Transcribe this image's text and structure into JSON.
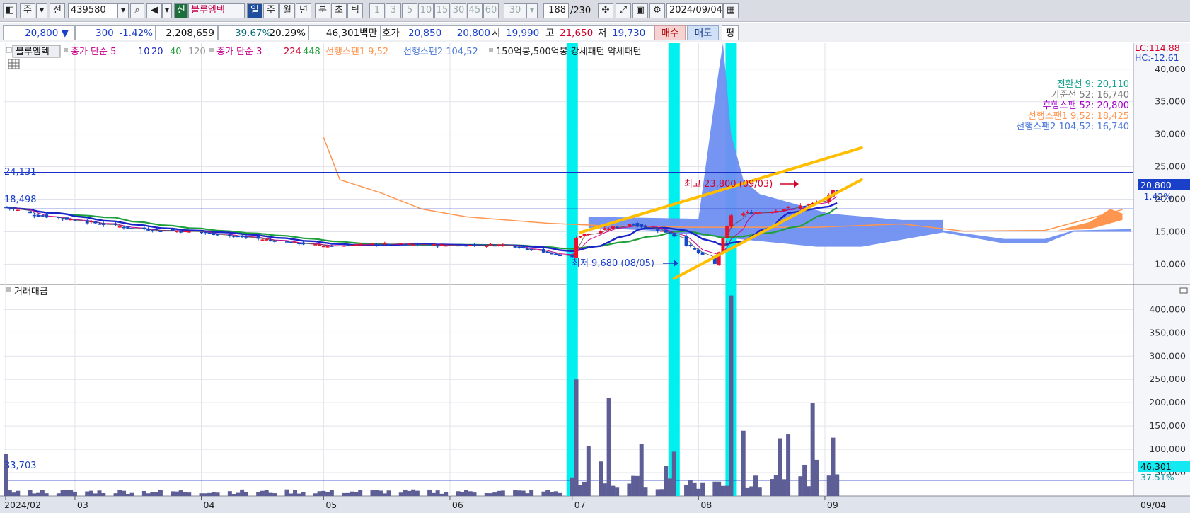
{
  "toolbar": {
    "period": "주",
    "prev": "전",
    "code": "439580",
    "new_badge": "신",
    "stock_name": "블루엠텍",
    "tf_day": "일",
    "tf_week": "주",
    "tf_month": "월",
    "tf_year": "년",
    "tf_min": "분",
    "tf_sec": "초",
    "tf_tick": "틱",
    "intervals": [
      "1",
      "3",
      "5",
      "10",
      "15",
      "30",
      "45",
      "60"
    ],
    "interval_select": "30",
    "count": "188",
    "count_total": "/230",
    "date": "2024/09/04"
  },
  "quote": {
    "price": "20,800",
    "change_arrow": "▼",
    "change": "300",
    "change_pct": "-1.42%",
    "volume": "2,208,659",
    "turnover_ratio": "39.67%",
    "vol_ratio": "20.29%",
    "amount": "46,301백만",
    "hoga_label": "호가",
    "ask": "20,850",
    "bid": "20,800",
    "open_label": "시",
    "open": "19,990",
    "high_label": "고",
    "high": "21,650",
    "low_label": "저",
    "low": "19,730",
    "buy": "매수",
    "sell": "매도",
    "avg": "평"
  },
  "legend": {
    "name": "블루엠텍",
    "ma1_label": "종가 단순 5",
    "ma1_periods": [
      "10",
      "20",
      "40",
      "120"
    ],
    "ma2_label": "종가 단순 3",
    "ma2_periods": [
      "224",
      "448"
    ],
    "span1": "선행스팬1 9,52",
    "span2": "선행스팬2 104,52",
    "pattern": "150억봉,500억봉 강세패턴 약세패턴",
    "lc": "LC:114.88",
    "hc": "HC:-12.61"
  },
  "ichimoku_info": [
    {
      "text": "전환선 9: 20,110",
      "color": "#14a08a"
    },
    {
      "text": "기준선 52: 16,740",
      "color": "#7a7a7a"
    },
    {
      "text": "후행스팬 52: 20,800",
      "color": "#a000c8"
    },
    {
      "text": "선행스팬1 9,52: 18,425",
      "color": "#ff9650"
    },
    {
      "text": "선행스팬2 104,52: 16,740",
      "color": "#4a78d8"
    }
  ],
  "annotations": {
    "level_high": "24,131",
    "level_mid": "18,498",
    "max_label": "최고 23,800 (09/03)",
    "min_label": "최저 9,680 (08/05)",
    "last_price": "20,800",
    "last_pct": "-1.42%",
    "vol_level": "33,703",
    "vol_last": "46,301",
    "vol_pct": "37.51%"
  },
  "volume_title": "거래대금",
  "colors": {
    "up": "#e8102c",
    "down": "#1548c8",
    "highlight": "#00f0f0",
    "channel": "#ffbe00",
    "cloud": "#6f8ef0",
    "cloud_pos": "#ff9650",
    "ma_blue": "#1a24c8",
    "ma_green": "#1fa03c",
    "volume": "#5e5e96"
  },
  "chart_data": [
    {
      "type": "candlestick",
      "title": "블루엠텍",
      "ylim": [
        7000,
        44000
      ],
      "y_ticks": [
        "40,000",
        "35,000",
        "30,000",
        "25,000",
        "20,000",
        "15,000",
        "10,000"
      ],
      "x_tick_labels": [
        "2024/02",
        "03",
        "04",
        "05",
        "06",
        "07",
        "08",
        "09"
      ],
      "date_axis_right": "09/04",
      "notable": {
        "max": 23800,
        "max_date": "09/03",
        "min": 9680,
        "min_date": "08/05",
        "last": 20800,
        "level_high": 24131,
        "level_mid": 18498
      },
      "series_close": [
        {
          "date": "2024-02-13",
          "close": 18800
        },
        {
          "date": "2024-02-20",
          "close": 17600
        },
        {
          "date": "2024-03-01",
          "close": 16800
        },
        {
          "date": "2024-03-15",
          "close": 15500
        },
        {
          "date": "2024-04-01",
          "close": 14900
        },
        {
          "date": "2024-04-15",
          "close": 13900
        },
        {
          "date": "2024-05-01",
          "close": 12800
        },
        {
          "date": "2024-05-15",
          "close": 13100
        },
        {
          "date": "2024-06-01",
          "close": 12900
        },
        {
          "date": "2024-06-15",
          "close": 13000
        },
        {
          "date": "2024-07-01",
          "close": 11000
        },
        {
          "date": "2024-07-02",
          "close": 14200
        },
        {
          "date": "2024-07-15",
          "close": 16300
        },
        {
          "date": "2024-07-25",
          "close": 14800
        },
        {
          "date": "2024-08-05",
          "close": 10000
        },
        {
          "date": "2024-08-09",
          "close": 17600
        },
        {
          "date": "2024-08-20",
          "close": 18300
        },
        {
          "date": "2024-08-30",
          "close": 19400
        },
        {
          "date": "2024-09-03",
          "close": 21100
        },
        {
          "date": "2024-09-04",
          "close": 20800
        }
      ]
    },
    {
      "type": "bar",
      "title": "거래대금",
      "ylim": [
        0,
        440000
      ],
      "y_ticks": [
        "400,000",
        "350,000",
        "300,000",
        "250,000",
        "200,000",
        "150,000",
        "100,000",
        "50,000"
      ],
      "reference_level": 33703,
      "notable_values": [
        {
          "date": "2024-02-13",
          "value": 90000
        },
        {
          "date": "2024-07-02",
          "value": 250000
        },
        {
          "date": "2024-07-10",
          "value": 210000
        },
        {
          "date": "2024-07-26",
          "value": 95000
        },
        {
          "date": "2024-08-09",
          "value": 430000
        },
        {
          "date": "2024-08-12",
          "value": 140000
        },
        {
          "date": "2024-08-29",
          "value": 200000
        },
        {
          "date": "2024-09-03",
          "value": 125000
        },
        {
          "date": "2024-09-04",
          "value": 46301
        }
      ]
    }
  ]
}
